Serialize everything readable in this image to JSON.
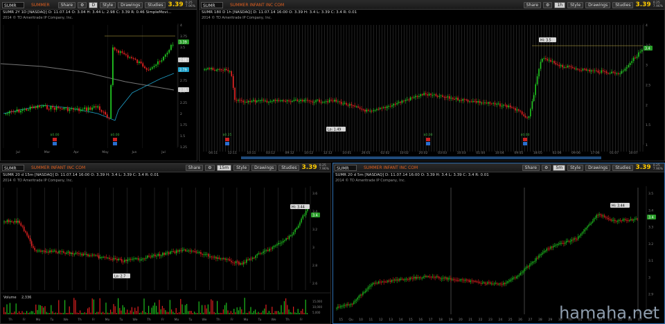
{
  "toolbar_labels": {
    "share": "Share",
    "style": "Style",
    "drawings": "Drawings",
    "studies": "Studies"
  },
  "charts": [
    {
      "id": "tl",
      "symbol": "SUMR",
      "company": "SUMMER",
      "aggregation": "D",
      "info": "SUMR 2Y 1D [NASDAQ]  O: 11.07.14  O: 3.04  H: 3.44  L: 2.98  C: 3.39  R: 0.46  SimpleMovi...",
      "copyright": "2014 © TD Ameritrade IP Company, Inc.",
      "last": "3.39",
      "change_top": "0.25",
      "change_bot": "7.96%",
      "price_labels": [
        {
          "text": "3.39",
          "color": "#2a9d2a"
        },
        {
          "text": "2.98",
          "color": "#cccccc"
        },
        {
          "text": "2.79",
          "color": "#1fa0c8"
        },
        {
          "text": "2.35",
          "color": "#cccccc"
        }
      ],
      "ticks": [
        "Jul",
        "Mar",
        "Apr",
        "May",
        "Jun",
        "Jul"
      ],
      "events": [
        "$0.00",
        "$0.00"
      ]
    },
    {
      "id": "tr",
      "symbol": "SUMR",
      "company": "SUMMER INFANT INC COM",
      "aggregation": "1h",
      "info": "SUMR 180 D 1h [NASDAQ]  D: 11.07.14 16:00  O: 3.39  H: 3.4  L: 3.39  C: 3.4  R: 0.01",
      "copyright": "2014 © TD Ameritrade IP Company, Inc.",
      "last": "3.39",
      "change_top": "0.25",
      "change_bot": "7.96%",
      "hi_label": "Hi: 3.5",
      "lo_label": "Lo: 1.49",
      "price_tag": "3.4",
      "ticks": [
        "04:11",
        "12:11",
        "10:11",
        "03:12",
        "09:12",
        "10:12",
        "12:12",
        "10:01",
        "26:01",
        "02:02",
        "10:02",
        "20:02",
        "03:03",
        "10:03",
        "01:04",
        "10:04",
        "09:05",
        "18:05",
        "02:06",
        "09:06",
        "17:06",
        "01:07",
        "10:07"
      ],
      "events": [
        "$0.25",
        "$0.00",
        "$0.00"
      ]
    },
    {
      "id": "bl",
      "symbol": "SUMR",
      "company": "SUMMER INFANT INC COM",
      "aggregation": "15m",
      "info": "SUMR 20 d 15m [NASDAQ]  D: 11.07.14 16:00  O: 3.39  H: 3.4  L: 3.39  C: 3.4  R: 0.01",
      "copyright": "2014 © TD Ameritrade IP Company, Inc.",
      "last": "3.39",
      "change_top": "0.25",
      "change_bot": "7.96%",
      "hi_label": "Hi: 3.44",
      "lo_label": "Lo: 2.7",
      "price_tag": "3.4",
      "volume_label": "Volume",
      "volume_value": "2,336",
      "ticks": [
        "Th",
        "Fr",
        "Mo",
        "Tu",
        "We",
        "Th",
        "Fr",
        "Mo",
        "Tu",
        "We",
        "Th",
        "Fr",
        "Mo",
        "Tu",
        "We",
        "Th",
        "Fr",
        "Mo",
        "Tu",
        "We",
        "Th",
        "Fr"
      ]
    },
    {
      "id": "br",
      "symbol": "SUMR",
      "company": "SUMMER INFANT INC COM",
      "aggregation": "5m",
      "info": "SUMR 20 d 5m [NASDAQ]  D: 11.07.14 16:00  O: 3.39  H: 3.4  L: 3.39  C: 3.4  R: 0.01",
      "copyright": "2014 © TD Ameritrade IP Company, Inc.",
      "last": "3.39",
      "change_top": "0.25",
      "change_bot": "7.96%",
      "hi_label": "Hi: 3.44",
      "price_tag": "3.4",
      "ticks": [
        "15",
        "Qu",
        "10",
        "11",
        "12",
        "13",
        "14",
        "15",
        "16",
        "17",
        "18",
        "19",
        "20",
        "21",
        "22",
        "23",
        "24",
        "25",
        "26",
        "27",
        "28",
        "29",
        "30",
        "Th",
        "01",
        "02",
        "03",
        "04",
        "05",
        "06",
        "07"
      ]
    }
  ],
  "watermark": "hamaha.net"
}
